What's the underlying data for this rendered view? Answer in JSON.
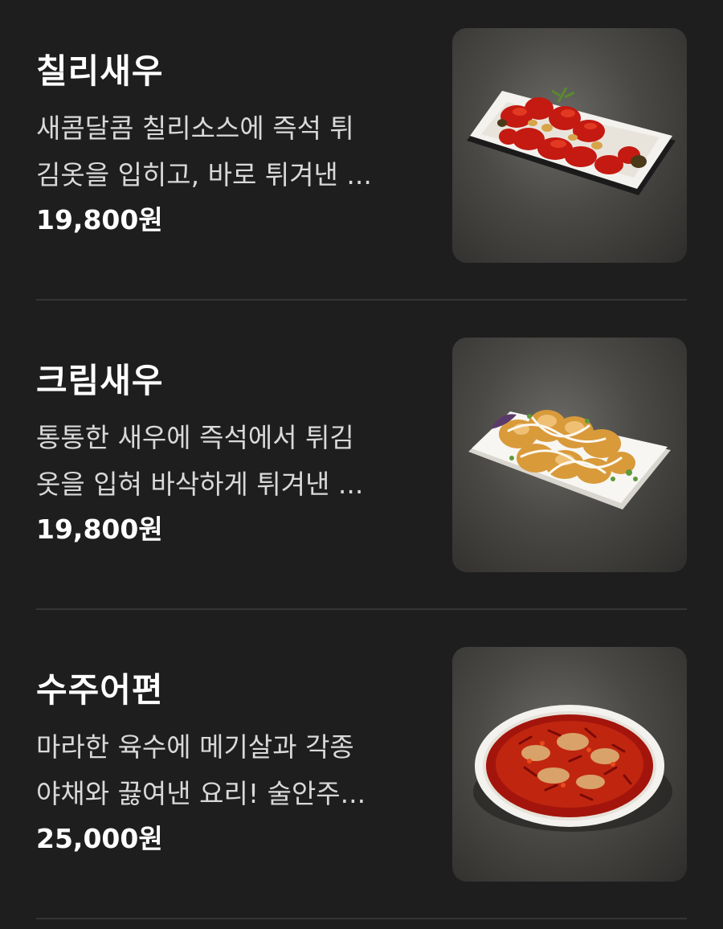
{
  "menu": {
    "items": [
      {
        "name": "칠리새우",
        "desc_line1": "새콤달콤 칠리소스에 즉석 튀",
        "desc_line2": "김옷을 입히고, 바로 튀겨낸 ...",
        "price": "19,800원",
        "image_icon": "chili-shrimp-dish"
      },
      {
        "name": "크림새우",
        "desc_line1": "통통한 새우에 즉석에서 튀김",
        "desc_line2": "옷을 입혀 바삭하게 튀겨낸 ...",
        "price": "19,800원",
        "image_icon": "cream-shrimp-dish"
      },
      {
        "name": "수주어편",
        "desc_line1": "마라한 육수에 메기살과 각종",
        "desc_line2": "야채와 끓여낸 요리! 술안주...",
        "price": "25,000원",
        "image_icon": "spicy-fish-bowl"
      }
    ]
  },
  "colors": {
    "background": "#1e1e1f",
    "divider": "#353537",
    "text_primary": "#ffffff",
    "text_secondary": "#d9d9d9"
  }
}
